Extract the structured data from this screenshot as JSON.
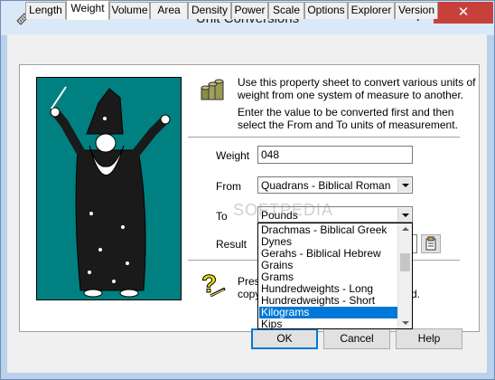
{
  "window": {
    "title": "Unit Conversions",
    "help_label": "?",
    "close_label": "✕"
  },
  "tabs": [
    {
      "label": "Length"
    },
    {
      "label": "Weight"
    },
    {
      "label": "Volume"
    },
    {
      "label": "Area"
    },
    {
      "label": "Density"
    },
    {
      "label": "Power"
    },
    {
      "label": "Scale"
    },
    {
      "label": "Options"
    },
    {
      "label": "Explorer"
    },
    {
      "label": "Version"
    }
  ],
  "intro": {
    "line1": "Use this property sheet to convert various units of",
    "line2": "weight from one system of measure to another.",
    "line3": "Enter the value to be converted first and then",
    "line4": "select the From and To units of measurement."
  },
  "form": {
    "weight_label": "Weight",
    "weight_value": "048",
    "from_label": "From",
    "from_value": "Quadrans - Biblical Roman",
    "to_label": "To",
    "to_value": "Pounds",
    "result_label": "Result"
  },
  "dropdown": {
    "items": [
      "Drachmas - Biblical Greek",
      "Dynes",
      "Gerahs - Biblical Hebrew",
      "Grains",
      "Grams",
      "Hundredweights - Long",
      "Hundredweights - Short",
      "Kilograms",
      "Kips"
    ],
    "selected": "Kilograms"
  },
  "help_text": {
    "line1": "Pres",
    "line2": "copy",
    "tail": "d."
  },
  "buttons": {
    "ok": "OK",
    "cancel": "Cancel",
    "help": "Help"
  },
  "watermark": "SOFTPEDIA",
  "colors": {
    "wizard_background": "#008080",
    "selection": "#0078d7",
    "close_button": "#c7413a"
  }
}
